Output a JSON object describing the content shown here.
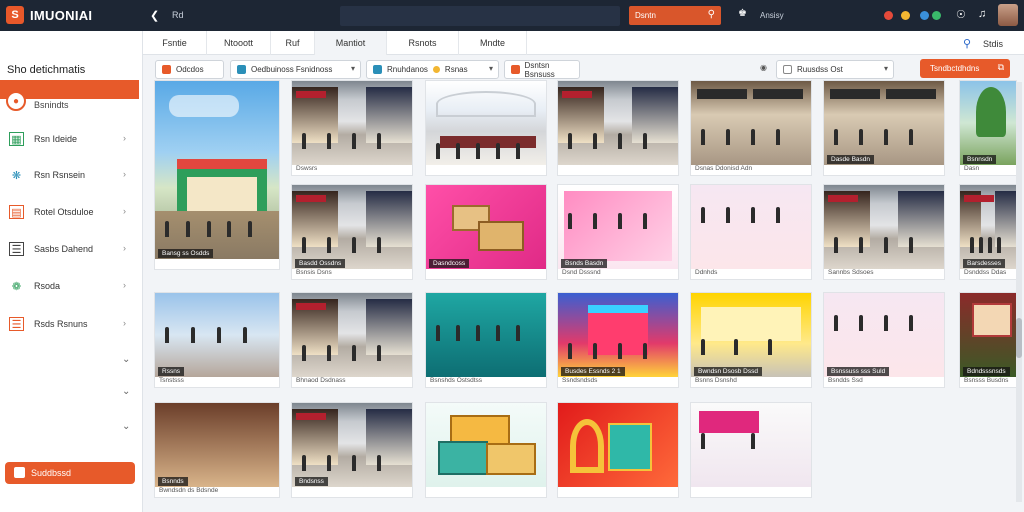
{
  "topbar": {
    "app_title": "IMUONIAI",
    "breadcrumb": "Rd",
    "search_orange": "Dsntn",
    "user_label": "Ansisy",
    "accent": "#e75a2a"
  },
  "tabs": [
    {
      "label": "Fsntie"
    },
    {
      "label": "Ntooott"
    },
    {
      "label": "Ruf"
    },
    {
      "label": "Mantiot"
    },
    {
      "label": "Rsnots"
    },
    {
      "label": "Mndte"
    }
  ],
  "tab_search_label": "Stdis",
  "sidebar": {
    "heading": "Sho detichmatis",
    "active_item": "Bsnindts",
    "items": [
      {
        "label": "Rsn Ideide",
        "icon": "grid-icon",
        "color": "#2e9e5b"
      },
      {
        "label": "Rsn Rsnsein",
        "icon": "network-icon",
        "color": "#2a8fb8"
      },
      {
        "label": "Rotel Otsduloe",
        "icon": "calendar-icon",
        "color": "#e75a2a"
      },
      {
        "label": "Sasbs Dahend",
        "icon": "table-icon",
        "color": "#444444"
      },
      {
        "label": "Rsoda",
        "icon": "gear-icon",
        "color": "#2e9e5b"
      },
      {
        "label": "Rsds Rsnuns",
        "icon": "list-icon",
        "color": "#e75a2a"
      }
    ],
    "button_label": "Suddbssd"
  },
  "filters": {
    "chip1": "Odcdos",
    "chip2": "Oedbuinoss Fsnidnoss",
    "chip3a": "Rnuhdanos",
    "chip3b": "Rsnas",
    "chip4": "Dsntsn Bsnsuss",
    "chip5": "Ruusdss Ost",
    "orange_button": "Tsndbctdhdns"
  },
  "cards": [
    {
      "cap": "",
      "tag": "Bansg ss Osdds"
    },
    {
      "cap": "Dswsrs",
      "tag": ""
    },
    {
      "cap": "",
      "tag": ""
    },
    {
      "cap": "",
      "tag": ""
    },
    {
      "cap": "Dsnas Ddonisd Adn",
      "tag": ""
    },
    {
      "cap": "",
      "tag": "Dasde Basdn"
    },
    {
      "cap": "Dasn",
      "tag": "Bsnnsdn"
    },
    {
      "cap": "Bsnsis Dsns",
      "tag": "Basdd Ossdns"
    },
    {
      "cap": "",
      "tag": "Dasndcoss"
    },
    {
      "cap": "Dsnd Dsssnd",
      "tag": "Bsnds Basdn"
    },
    {
      "cap": "Ddnhds",
      "tag": ""
    },
    {
      "cap": "Sannbs Sdsoes",
      "tag": ""
    },
    {
      "cap": "Dsnddss Ddas",
      "tag": "Barsdesses"
    },
    {
      "cap": "Tsnstsss",
      "tag": "Rssns"
    },
    {
      "cap": "Bhnaod Dsdnass",
      "tag": ""
    },
    {
      "cap": "Bsnshds Ostsdtss",
      "tag": ""
    },
    {
      "cap": "Ssndsndsds",
      "tag": "Busdes Essnds 2 1"
    },
    {
      "cap": "Bsnns Dsnshd",
      "tag": "Bwndsn Dsosb Dssd"
    },
    {
      "cap": "Bsndds Ssd",
      "tag": "Bsnssuss sss Suld"
    },
    {
      "cap": "Bsnsss Busdns",
      "tag": "Bdndsssnsds"
    },
    {
      "cap": "Bwndsdn ds Bdsnde",
      "tag": "Bsnnds"
    },
    {
      "cap": "",
      "tag": "Bndsnss"
    },
    {
      "cap": "",
      "tag": ""
    },
    {
      "cap": "",
      "tag": ""
    },
    {
      "cap": "",
      "tag": ""
    },
    {
      "cap": "",
      "tag": ""
    },
    {
      "cap": "",
      "tag": ""
    }
  ]
}
